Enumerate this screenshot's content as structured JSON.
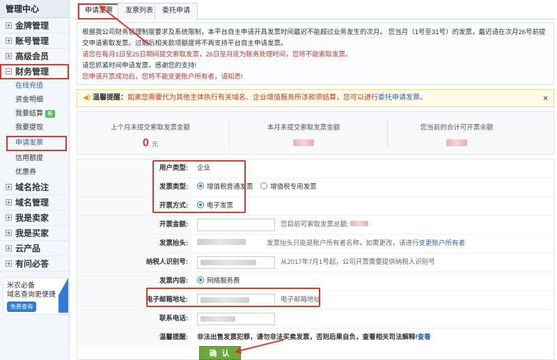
{
  "sidebar": {
    "title": "管理中心",
    "items": [
      {
        "label": "金牌管理"
      },
      {
        "label": "账号管理"
      },
      {
        "label": "高级会员"
      },
      {
        "label": "财务管理"
      },
      {
        "label": "域名抢注"
      },
      {
        "label": "域名管理"
      },
      {
        "label": "我是卖家"
      },
      {
        "label": "我是买家"
      },
      {
        "label": "云产品"
      },
      {
        "label": "有问必答"
      }
    ],
    "finance_sub": [
      {
        "label": "在线充值"
      },
      {
        "label": "资金明细"
      },
      {
        "label": "我要结算",
        "badge": "新"
      },
      {
        "label": "我要提现"
      },
      {
        "label": "申请发票"
      },
      {
        "label": "信用额度"
      },
      {
        "label": "优惠券"
      }
    ],
    "ad": {
      "line1": "米农必备",
      "line2": "域名查询更便捷",
      "button": "免费查询"
    }
  },
  "tabs": [
    {
      "label": "申请发票"
    },
    {
      "label": "发票列表"
    },
    {
      "label": "委托申请"
    }
  ],
  "notice": {
    "p1": "根据我公司财务管理制度要求及系统限制，本平台自主申请开具发票时间最迟不能超过业务发生的次月。 您当月（1号至31号）的发票，最迟请在次月26号前提交申请索取发票。过期后相关款项额度将不再支持平台自主申请发票。",
    "p2": "请您在每月1日至25日期间提交索取发票，26日至月底为账务处理时间，您将不能索取发票。",
    "p3": "请您抓紧时间申请发票，感谢您的支持!",
    "p4": "您申请开票成功后，您将不能变更账户所有者，请知悉!"
  },
  "tip": {
    "label": "温馨提醒：",
    "text": "如果您需要代为其他主体执行有关域名、企业增值服务所涉款项结算，您可以进行",
    "link": "委托申请发票",
    "end": "。",
    "close": "×"
  },
  "stats": [
    {
      "label": "上个月未提交索取发票金额",
      "value": "0",
      "unit": "元"
    },
    {
      "label": "本月未提交索取发票金额"
    },
    {
      "label": "您当前的合计可开票余额"
    }
  ],
  "form": {
    "user_type": {
      "label": "用户类型:",
      "value": "企业"
    },
    "invoice_type": {
      "label": "发票类型:",
      "option1": "增值税普通发票",
      "option2": "增值税专用发票"
    },
    "issue_method": {
      "label": "开票方式:",
      "option": "电子发票"
    },
    "amount": {
      "label": "开票金额:",
      "hint": "您目前可索取发票总额:"
    },
    "header": {
      "label": "发票抬头:",
      "hint": "发票抬头只能是账户所有者名称，如需更改，请进行",
      "link": "变更账户所有者"
    },
    "tax_id": {
      "label": "纳税人识别号:",
      "hint": "从2017年7月1号起，公司开票需要提供纳税人识别号"
    },
    "content": {
      "label": "发票内容:",
      "option": "网络服务费"
    },
    "email": {
      "label": "电子邮箱地址:",
      "hint": "电子邮箱地址"
    },
    "phone": {
      "label": "联系电话:"
    },
    "warning": {
      "label": "温馨提醒:",
      "text": "非法出售发票犯罪，请勿非法买卖发票，否则后果自负，查看相关司法解释!",
      "link": "查看"
    },
    "confirm": "确 认"
  },
  "colors": {
    "accent": "#2f7bd9",
    "alert": "#d8392b",
    "confirm": "#6aaa3a"
  }
}
